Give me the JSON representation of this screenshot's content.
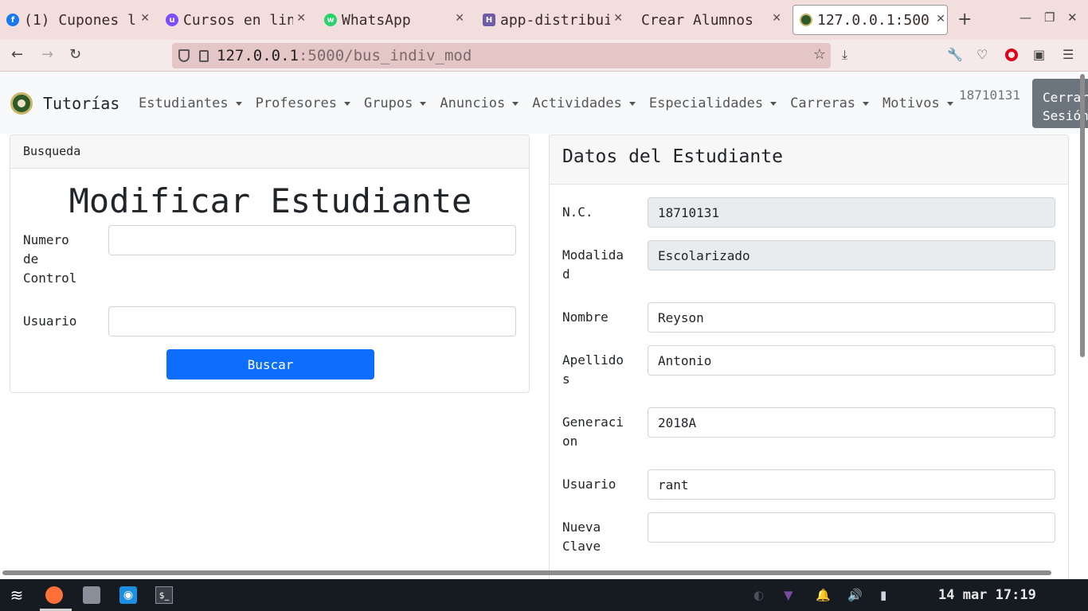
{
  "browser": {
    "tabs": [
      {
        "title": "(1) Cupones l",
        "icon": "facebook-icon",
        "color": "#1877f2",
        "glyph": "f"
      },
      {
        "title": "Cursos en lin",
        "icon": "udemy-icon",
        "color": "#7c4dff",
        "glyph": "u"
      },
      {
        "title": "WhatsApp",
        "icon": "whatsapp-icon",
        "color": "#25d366",
        "glyph": "w"
      },
      {
        "title": "app-distribui",
        "icon": "heroku-icon",
        "color": "#6e5ca8",
        "glyph": "H"
      },
      {
        "title": "Crear Alumnos",
        "icon": "",
        "color": "",
        "glyph": ""
      },
      {
        "title": "127.0.0.1:500",
        "icon": "site-seal-icon",
        "color": "#2e5a2a",
        "glyph": "●"
      }
    ],
    "url_host": "127.0.0.1",
    "url_path": ":5000/bus_indiv_mod"
  },
  "navbar": {
    "brand": "Tutorías",
    "items": [
      "Estudiantes",
      "Profesores",
      "Grupos",
      "Anuncios",
      "Actividades",
      "Especialidades",
      "Carreras",
      "Motivos"
    ],
    "user": "18710131",
    "logout_line1": "Cerrar",
    "logout_line2": "Sesión"
  },
  "search": {
    "header": "Busqueda",
    "title": "Modificar Estudiante",
    "control_label_1": "Numero",
    "control_label_2": "de",
    "control_label_3": "Control",
    "control_value": "",
    "user_label": "Usuario",
    "user_value": "",
    "button": "Buscar"
  },
  "student": {
    "header": "Datos del Estudiante",
    "nc_label": "N.C.",
    "nc_value": "18710131",
    "modalidad_label_1": "Modalida",
    "modalidad_label_2": "d",
    "modalidad_value": "Escolarizado",
    "nombre_label": "Nombre",
    "nombre_value": "Reyson",
    "apellidos_label_1": "Apellido",
    "apellidos_label_2": "s",
    "apellidos_value": "Antonio",
    "generacion_label_1": "Generaci",
    "generacion_label_2": "on",
    "generacion_value": "2018A",
    "usuario_label": "Usuario",
    "usuario_value": "rant",
    "clave_label_1": "Nueva",
    "clave_label_2": "Clave",
    "clave_value": ""
  },
  "taskbar": {
    "clock": "14 mar 17:19"
  },
  "colors": {
    "primary": "#0d6efd",
    "secondary": "#6c757d",
    "tab_strip": "#f3dede"
  }
}
